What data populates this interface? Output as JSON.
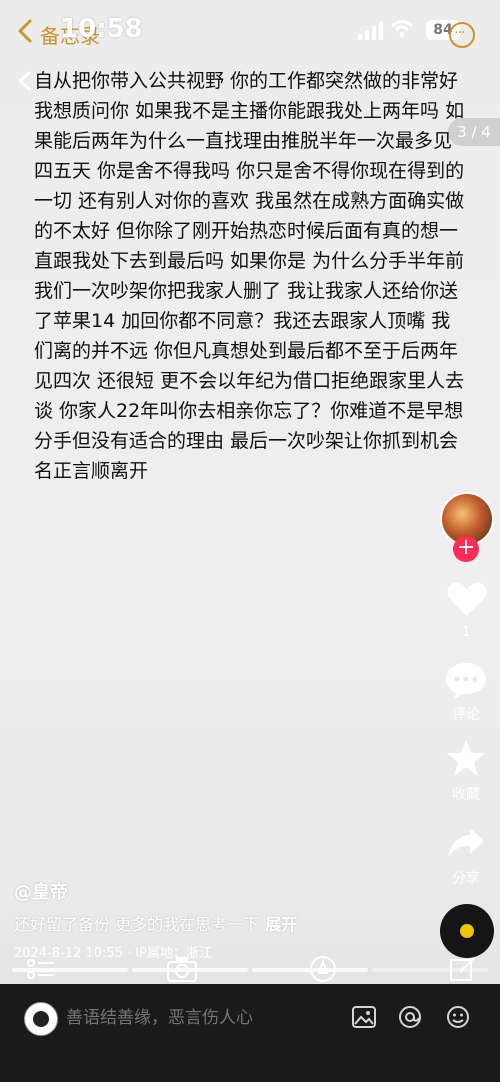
{
  "status_bar": {
    "back_label": "备忘录",
    "time": "10:58",
    "battery": "84"
  },
  "post": {
    "ghost_top_text": "自从把你带入公共视野",
    "text": "自从把你带入公共视野 你的工作都突然做的非常好 我想质问你 如果我不是主播你能跟我处上两年吗 如果能后两年为什么一直找理由推脱半年一次最多见四五天 你是舍不得我吗 你只是舍不得你现在得到的一切 还有别人对你的喜欢 我虽然在成熟方面确实做的不太好 但你除了刚开始热恋时候后面有真的想一直跟我处下去到最后吗 如果你是 为什么分手半年前我们一次吵架你把我家人删了 我让我家人还给你送了苹果14 加回你都不同意？我还去跟家人顶嘴 我们离的并不远 你但凡真想处到最后都不至于后两年见四次 还很短 更不会以年纪为借口拒绝跟家里人去谈 你家人22年叫你去相亲你忘了？你难道不是早想分手但没有适合的理由 最后一次吵架让你抓到机会名正言顺离开",
    "page_indicator": "3 / 4"
  },
  "rail": {
    "like_count": "1",
    "comment_label": "评论",
    "favorite_label": "收藏",
    "share_label": "分享"
  },
  "info": {
    "author": "@皇帝",
    "caption": "还好留了备份 更多的我在思考一下",
    "expand_label": "展开",
    "date_location": "2024-8-12 10:55 · IP属地：浙江"
  },
  "comment_bar": {
    "placeholder": "善语结善缘，恶言伤人心"
  },
  "colors": {
    "accent": "#c7962e",
    "follow": "#ff2c55",
    "disc_center": "#f0c200"
  }
}
